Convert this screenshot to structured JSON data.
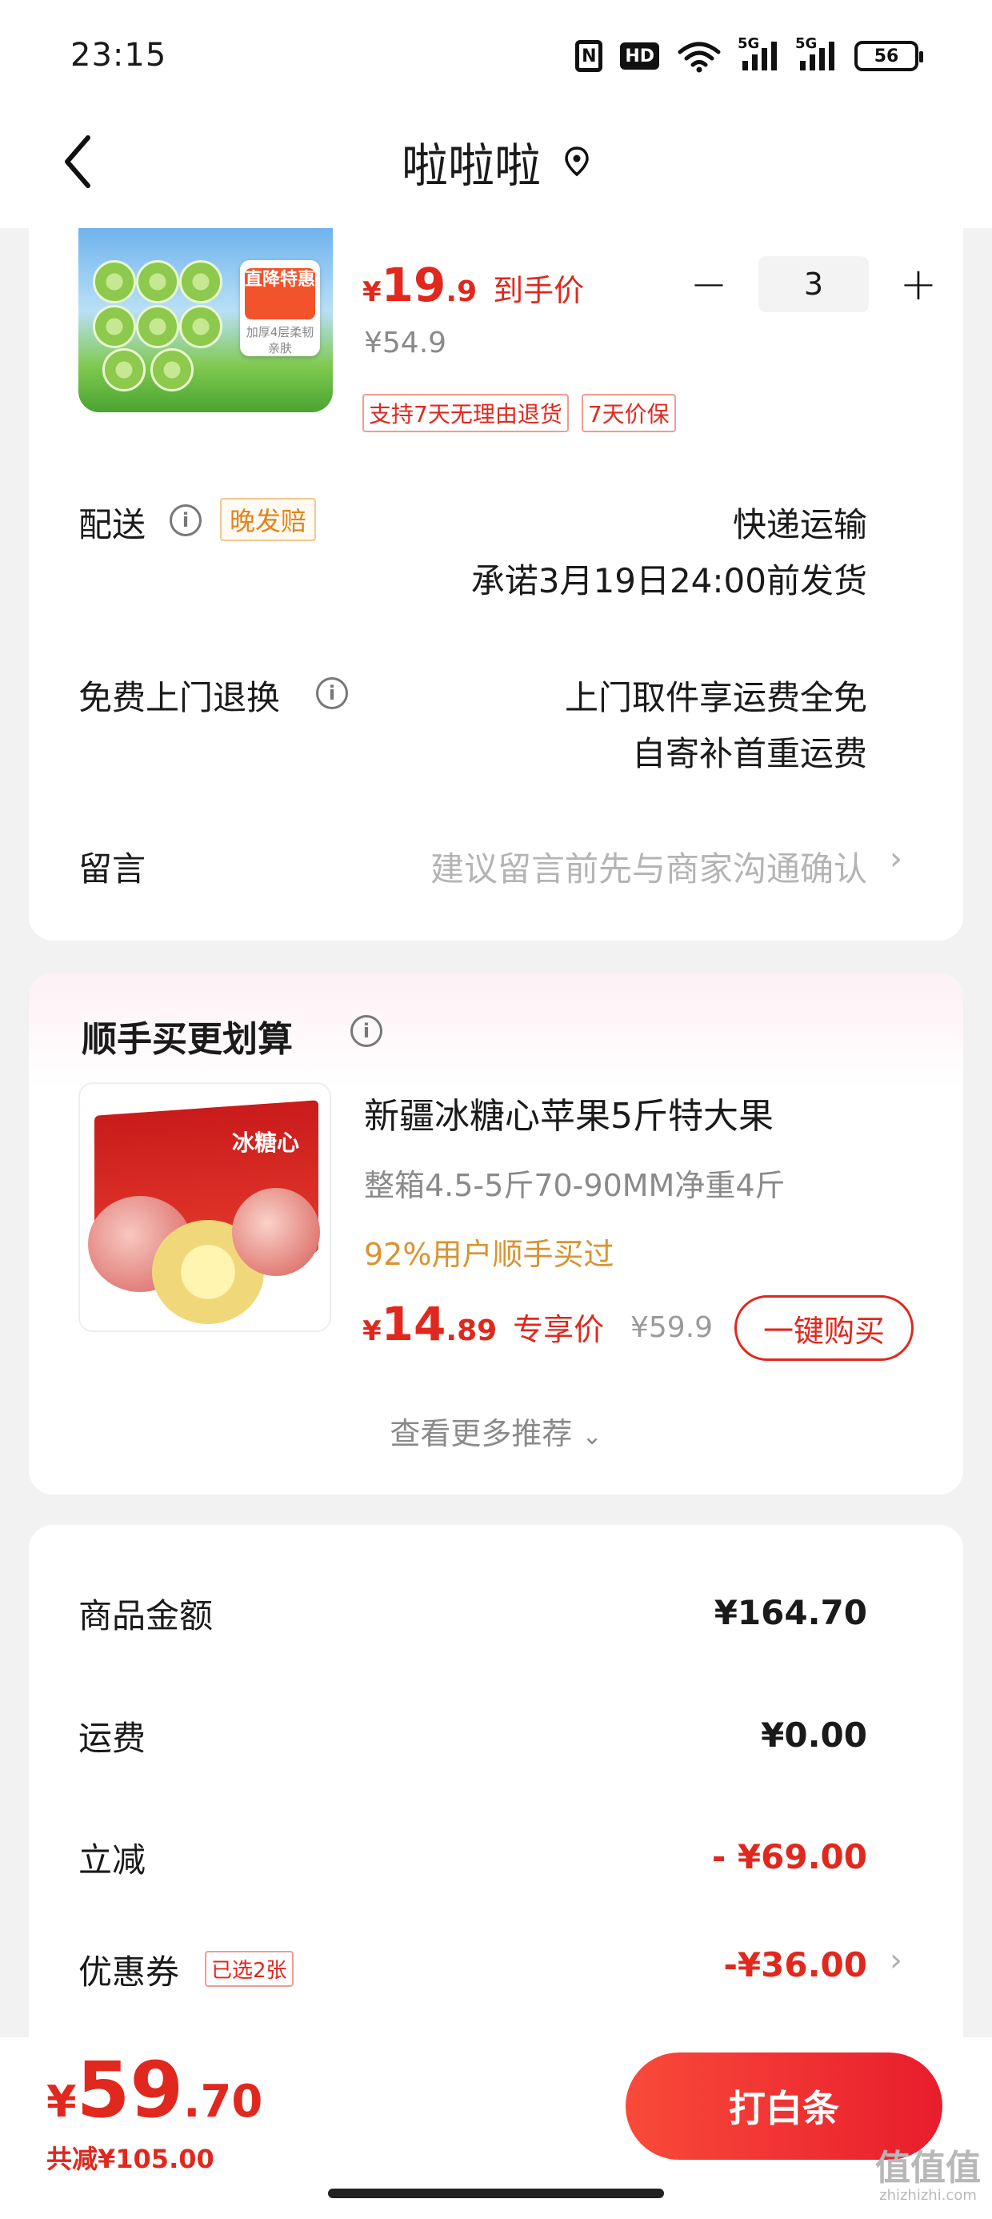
{
  "status_bar": {
    "time": "23:15",
    "nfc_label": "N",
    "hd_label": "HD",
    "network_label_1": "5G",
    "network_label_2": "5G",
    "battery": "56"
  },
  "header": {
    "title": "啦啦啦",
    "back_icon": "chevron-left-icon",
    "location_icon": "location-pin-icon"
  },
  "product": {
    "image_badge_top": "直降特惠",
    "image_badge_bottom": "加厚4层柔韧亲肤",
    "price_currency": "¥",
    "price_int": "19",
    "price_dec": ".9",
    "price_label": "到手价",
    "original_price": "¥54.9",
    "service_tags": [
      "支持7天无理由退货",
      "7天价保"
    ],
    "quantity": "3",
    "minus_label": "−",
    "plus_label": "+"
  },
  "delivery": {
    "label": "配送",
    "badge": "晚发赔",
    "method": "快递运输",
    "promise": "承诺3月19日24:00前发货"
  },
  "return": {
    "label": "免费上门退换",
    "line1": "上门取件享运费全免",
    "line2": "自寄补首重运费"
  },
  "message": {
    "label": "留言",
    "placeholder": "建议留言前先与商家沟通确认"
  },
  "recommend": {
    "title": "顺手买更划算",
    "image_label": "冰糖心",
    "product_title": "新疆冰糖心苹果5斤特大果",
    "subtitle": "整箱4.5-5斤70-90MM净重4斤",
    "percent_text": "92%用户顺手买过",
    "price_currency": "¥",
    "price_int": "14",
    "price_dec": ".89",
    "price_label": "专享价",
    "original_price": "¥59.9",
    "buy_button": "一键购买",
    "more_link": "查看更多推荐"
  },
  "summary": {
    "goods_label": "商品金额",
    "goods_value": "¥164.70",
    "shipping_label": "运费",
    "shipping_value": "¥0.00",
    "discount_label": "立减",
    "discount_value": "- ¥69.00",
    "coupon_label": "优惠券",
    "coupon_badge": "已选2张",
    "coupon_value": "-¥36.00"
  },
  "footer": {
    "total_currency": "¥",
    "total_int": "59",
    "total_dec": ".70",
    "saved_text": "共减¥105.00",
    "pay_button": "打白条"
  },
  "watermark": {
    "text": "值值值",
    "sub": "zhizhizhi.com"
  },
  "colors": {
    "accent_red": "#e0281e",
    "orange_text": "#d99330",
    "background": "#f2f2f2"
  }
}
